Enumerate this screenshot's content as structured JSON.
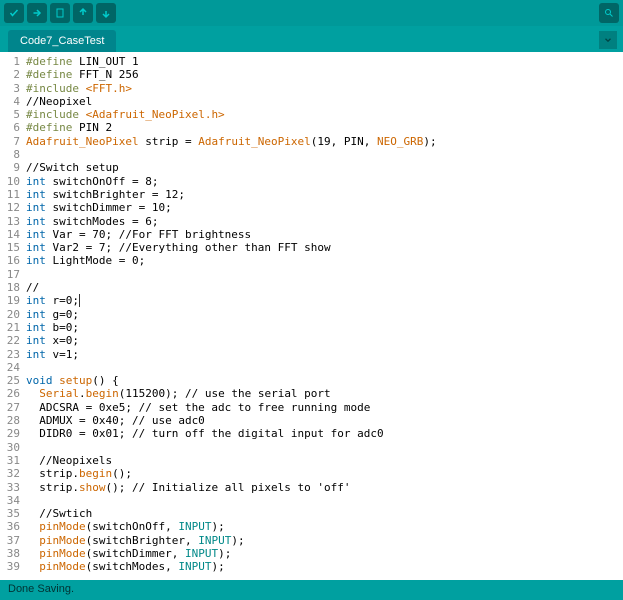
{
  "toolbar": {
    "verify_tip": "Verify",
    "upload_tip": "Upload",
    "new_tip": "New",
    "open_tip": "Open",
    "save_tip": "Save",
    "monitor_tip": "Serial Monitor"
  },
  "tabs": {
    "active": "Code7_CaseTest"
  },
  "status": {
    "text": "Done Saving."
  },
  "lines": [
    {
      "n": 1,
      "seg": [
        [
          "pre",
          "#define"
        ],
        [
          "",
          ". LIN_OUT 1"
        ]
      ]
    },
    {
      "n": 2,
      "seg": [
        [
          "pre",
          "#define"
        ],
        [
          "",
          ". FFT_N 256"
        ]
      ]
    },
    {
      "n": 3,
      "seg": [
        [
          "pre",
          "#include "
        ],
        [
          "lib",
          "<FFT.h>"
        ]
      ]
    },
    {
      "n": 4,
      "seg": [
        [
          "",
          "//Neopixel"
        ]
      ]
    },
    {
      "n": 5,
      "seg": [
        [
          "pre",
          "#include "
        ],
        [
          "lib",
          "<Adafruit_NeoPixel.h>"
        ]
      ]
    },
    {
      "n": 6,
      "seg": [
        [
          "pre",
          "#define"
        ],
        [
          "",
          ". PIN 2"
        ]
      ]
    },
    {
      "n": 7,
      "seg": [
        [
          "lib",
          "Adafruit_NeoPixel"
        ],
        [
          "",
          " strip = "
        ],
        [
          "lib",
          "Adafruit_NeoPixel"
        ],
        [
          "",
          "(19, PIN, "
        ],
        [
          "lib",
          "NEO_GRB"
        ],
        [
          "",
          ");"
        ]
      ]
    },
    {
      "n": 8,
      "seg": [
        [
          "",
          ""
        ]
      ]
    },
    {
      "n": 9,
      "seg": [
        [
          "",
          "//Switch setup"
        ]
      ]
    },
    {
      "n": 10,
      "seg": [
        [
          "type",
          "int"
        ],
        [
          "",
          " switchOnOff = 8;"
        ]
      ]
    },
    {
      "n": 11,
      "seg": [
        [
          "type",
          "int"
        ],
        [
          "",
          " switchBrighter = 12;"
        ]
      ]
    },
    {
      "n": 12,
      "seg": [
        [
          "type",
          "int"
        ],
        [
          "",
          " switchDimmer = 10;"
        ]
      ]
    },
    {
      "n": 13,
      "seg": [
        [
          "type",
          "int"
        ],
        [
          "",
          " switchModes = 6;"
        ]
      ]
    },
    {
      "n": 14,
      "seg": [
        [
          "type",
          "int"
        ],
        [
          "",
          " Var = 70; //For FFT brightness"
        ]
      ]
    },
    {
      "n": 15,
      "seg": [
        [
          "type",
          "int"
        ],
        [
          "",
          " Var2 = 7; //Everything other than FFT show"
        ]
      ]
    },
    {
      "n": 16,
      "seg": [
        [
          "type",
          "int"
        ],
        [
          "",
          " LightMode = 0;"
        ]
      ]
    },
    {
      "n": 17,
      "seg": [
        [
          "",
          ""
        ]
      ]
    },
    {
      "n": 18,
      "seg": [
        [
          "",
          "//"
        ]
      ]
    },
    {
      "n": 19,
      "seg": [
        [
          "type",
          "int"
        ],
        [
          "",
          " r=0;"
        ]
      ],
      "caret": true
    },
    {
      "n": 20,
      "seg": [
        [
          "type",
          "int"
        ],
        [
          "",
          " g=0;"
        ]
      ]
    },
    {
      "n": 21,
      "seg": [
        [
          "type",
          "int"
        ],
        [
          "",
          " b=0;"
        ]
      ]
    },
    {
      "n": 22,
      "seg": [
        [
          "type",
          "int"
        ],
        [
          "",
          " x=0;"
        ]
      ]
    },
    {
      "n": 23,
      "seg": [
        [
          "type",
          "int"
        ],
        [
          "",
          " v=1;"
        ]
      ]
    },
    {
      "n": 24,
      "seg": [
        [
          "",
          ""
        ]
      ]
    },
    {
      "n": 25,
      "seg": [
        [
          "type",
          "void"
        ],
        [
          "",
          " "
        ],
        [
          "lib",
          "setup"
        ],
        [
          "",
          "() {"
        ]
      ]
    },
    {
      "n": 26,
      "seg": [
        [
          "",
          "  "
        ],
        [
          "lib",
          "Serial"
        ],
        [
          "",
          "."
        ],
        [
          "lib",
          "begin"
        ],
        [
          "",
          "(115200); // use the serial port"
        ]
      ]
    },
    {
      "n": 27,
      "seg": [
        [
          "",
          "  ADCSRA = 0xe5; // set the adc to free running mode"
        ]
      ]
    },
    {
      "n": 28,
      "seg": [
        [
          "",
          "  ADMUX = 0x40; // use adc0"
        ]
      ]
    },
    {
      "n": 29,
      "seg": [
        [
          "",
          "  DIDR0 = 0x01; // turn off the digital input for adc0"
        ]
      ]
    },
    {
      "n": 30,
      "seg": [
        [
          "",
          ""
        ]
      ]
    },
    {
      "n": 31,
      "seg": [
        [
          "",
          "  //Neopixels"
        ]
      ]
    },
    {
      "n": 32,
      "seg": [
        [
          "",
          "  strip."
        ],
        [
          "lib",
          "begin"
        ],
        [
          "",
          "();"
        ]
      ]
    },
    {
      "n": 33,
      "seg": [
        [
          "",
          "  strip."
        ],
        [
          "lib",
          "show"
        ],
        [
          "",
          "(); // Initialize all pixels to 'off'"
        ]
      ]
    },
    {
      "n": 34,
      "seg": [
        [
          "",
          ""
        ]
      ]
    },
    {
      "n": 35,
      "seg": [
        [
          "",
          "  //Swtich"
        ]
      ]
    },
    {
      "n": 36,
      "seg": [
        [
          "",
          "  "
        ],
        [
          "lib",
          "pinMode"
        ],
        [
          "",
          "(switchOnOff, "
        ],
        [
          "str",
          "INPUT"
        ],
        [
          "",
          ");"
        ]
      ]
    },
    {
      "n": 37,
      "seg": [
        [
          "",
          "  "
        ],
        [
          "lib",
          "pinMode"
        ],
        [
          "",
          "(switchBrighter, "
        ],
        [
          "str",
          "INPUT"
        ],
        [
          "",
          ");"
        ]
      ]
    },
    {
      "n": 38,
      "seg": [
        [
          "",
          "  "
        ],
        [
          "lib",
          "pinMode"
        ],
        [
          "",
          "(switchDimmer, "
        ],
        [
          "str",
          "INPUT"
        ],
        [
          "",
          ");"
        ]
      ]
    },
    {
      "n": 39,
      "seg": [
        [
          "",
          "  "
        ],
        [
          "lib",
          "pinMode"
        ],
        [
          "",
          "(switchModes, "
        ],
        [
          "str",
          "INPUT"
        ],
        [
          "",
          ");"
        ]
      ]
    }
  ]
}
